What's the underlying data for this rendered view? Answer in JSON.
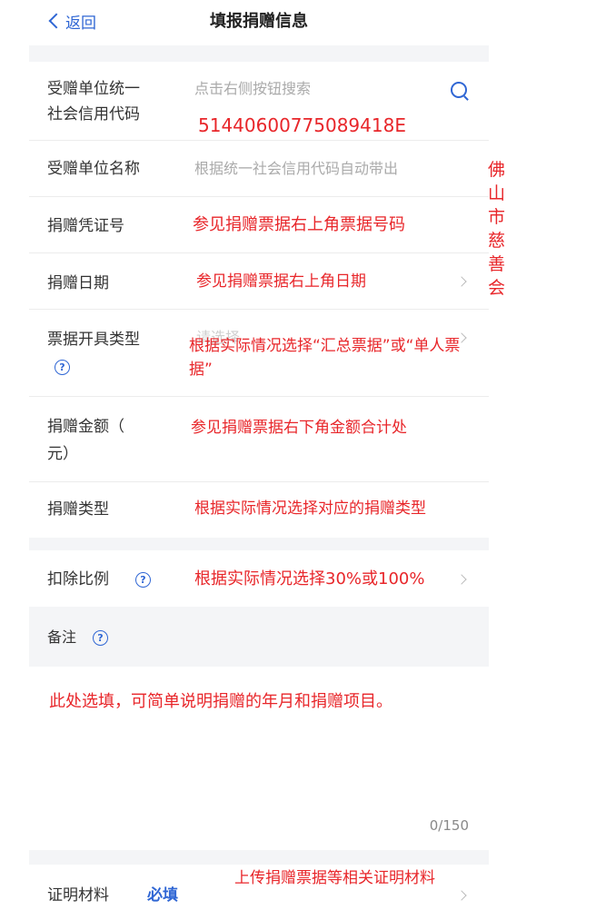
{
  "header": {
    "back_label": "返回",
    "title": "填报捐赠信息"
  },
  "fields": {
    "unit_code": {
      "label_line1": "受赠单位统一",
      "label_line2": "社会信用代码",
      "placeholder": "点击右侧按钮搜索",
      "note": "51440600775089418E"
    },
    "unit_name": {
      "label": "受赠单位名称",
      "placeholder": "根据统一社会信用代码自动带出",
      "note": "佛山市慈善会"
    },
    "voucher_no": {
      "label": "捐赠凭证号",
      "note": "参见捐赠票据右上角票据号码"
    },
    "donation_date": {
      "label": "捐赠日期",
      "note": "参见捐赠票据右上角日期"
    },
    "invoice_type": {
      "label": "票据开具类型",
      "placeholder": "请选择",
      "note_line1": "根据实际情况选择“汇总票据”或“单人票",
      "note_line2": "据”"
    },
    "amount": {
      "label_line1": "捐赠金额（",
      "label_line2": "元）",
      "note": "参见捐赠票据右下角金额合计处"
    },
    "donation_type": {
      "label": "捐赠类型",
      "note": "根据实际情况选择对应的捐赠类型"
    },
    "deduction_ratio": {
      "label": "扣除比例",
      "note": "根据实际情况选择30%或100%"
    },
    "remarks": {
      "label": "备注",
      "note": "此处选填，可简单说明捐赠的年月和捐赠项目。",
      "counter": "0/150"
    },
    "proof": {
      "label": "证明材料",
      "required": "必填",
      "note": "上传捐赠票据等相关证明材料"
    }
  },
  "icons": {
    "help": "?"
  },
  "colors": {
    "accent": "#2f66d4",
    "annotation": "#e8262a"
  }
}
